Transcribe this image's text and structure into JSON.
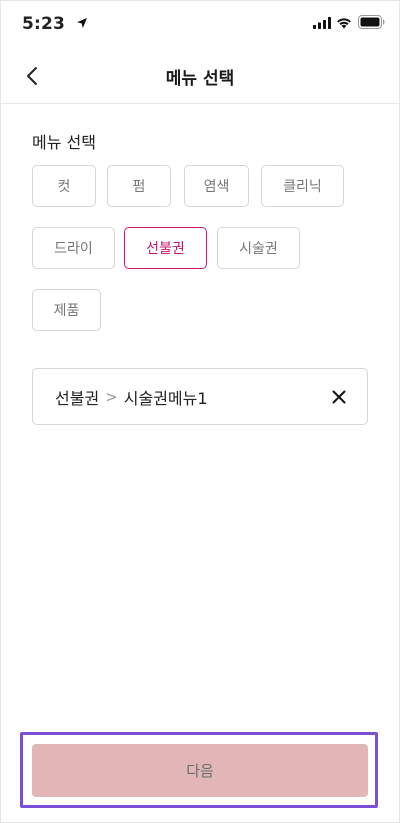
{
  "status_bar": {
    "time": "5:23",
    "icons": [
      "location-arrow-icon",
      "cellular-signal-icon",
      "wifi-icon",
      "battery-icon"
    ]
  },
  "header": {
    "back_icon": "chevron-left-icon",
    "title": "메뉴 선택"
  },
  "section": {
    "label": "메뉴 선택"
  },
  "categories": [
    {
      "label": "컷",
      "selected": false
    },
    {
      "label": "펌",
      "selected": false
    },
    {
      "label": "염색",
      "selected": false
    },
    {
      "label": "클리닉",
      "selected": false
    },
    {
      "label": "드라이",
      "selected": false
    },
    {
      "label": "선불권",
      "selected": true
    },
    {
      "label": "시술권",
      "selected": false
    },
    {
      "label": "제품",
      "selected": false
    }
  ],
  "selected_item": {
    "category": "선불권",
    "separator": ">",
    "menu": "시술권메뉴1",
    "remove_icon": "close-icon"
  },
  "footer": {
    "next_label": "다음"
  },
  "colors": {
    "accent": "#d0187a",
    "next_button_bg": "#e2b6b7",
    "highlight_border": "#7b4fd6"
  }
}
